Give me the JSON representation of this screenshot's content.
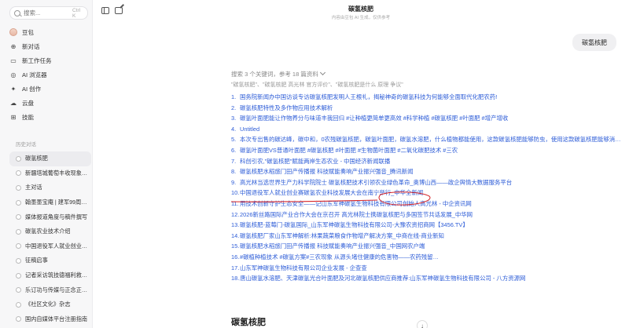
{
  "sidebar": {
    "search_placeholder": "搜索...",
    "search_shortcut": "Ctrl K",
    "nav": [
      {
        "label": "豆包",
        "icon": "avatar"
      },
      {
        "label": "新对话",
        "icon": "plus"
      },
      {
        "label": "新工作任务",
        "icon": "briefcase"
      },
      {
        "label": "AI 浏览器",
        "icon": "browser"
      },
      {
        "label": "AI 创作",
        "icon": "sparkle"
      },
      {
        "label": "云盘",
        "icon": "cloud"
      },
      {
        "label": "技能",
        "icon": "grid"
      }
    ],
    "history_title": "历史对话",
    "history": [
      {
        "label": "碳氢核肥",
        "active": true
      },
      {
        "label": "新疆塔城葡萄丰收现象…",
        "active": false
      },
      {
        "label": "主对话",
        "active": false
      },
      {
        "label": "翰墨墨宝庵 | 建军99周…",
        "active": false
      },
      {
        "label": "媒体报道角度与稿件撰写",
        "active": false
      },
      {
        "label": "碳氢农业技术介绍",
        "active": false
      },
      {
        "label": "中国退役军人就业创业…",
        "active": false
      },
      {
        "label": "征稿启事",
        "active": false
      },
      {
        "label": "记者采访筑技德福利救…",
        "active": false
      },
      {
        "label": "乐订功与传媒与正念正…",
        "active": false
      },
      {
        "label": "《社区文化》杂志",
        "active": false
      },
      {
        "label": "国内自媒体平台注册指南",
        "active": false
      }
    ]
  },
  "header": {
    "title": "碳氢核肥",
    "subtitle": "内容由豆包 AI 生成，仅供参考"
  },
  "chat": {
    "user_message": "碳氢核肥",
    "search_summary": "搜索 3 个关键词，参考 18 篇资料",
    "queries": "\"碳氢核肥\"、\"碳氢核肥 高光林 官方评价\"、\"碳氢核肥是什么 原理 争议\"",
    "results": [
      {
        "n": "1.",
        "text": "国务院新闻办中国访谈专访碳氢核肥发明人王根礼，揭秘神奇的碳氢科技为何能够全面取代化肥农药!"
      },
      {
        "n": "2.",
        "text": "碳氢核肥特性及多作物应用技术解析"
      },
      {
        "n": "3.",
        "text": "碳氢叶面肥能让作物养分与味道丰我回归 #让种植更简单更高效 #科学种植 #碳氢核肥 #叶面肥 #增产增收"
      },
      {
        "n": "4.",
        "text": "Untitled"
      },
      {
        "n": "5.",
        "text": "本次专出售的碳达峰，碳中和，0农残碳氢核肥，碳氢叶面肥，碳氢水溶肥，什么植物都能使用，这款碳氢核肥能够防虫，使用这款碳氢核肥能够消除重金…"
      },
      {
        "n": "6.",
        "text": "碳氢叶面肥VS普通叶面肥 #碳氢核肥 #叶面肥 #生物菌叶面肥 #二氧化碳肥技术 #三农"
      },
      {
        "n": "7.",
        "text": "科创引农,\"碳氢核肥\"赋能两岸生态农业 - 中国经济新闻联播"
      },
      {
        "n": "8.",
        "text": "碳氢核肥水稻旅门田产传播报 科技赋能奏响产业振兴强音_腾讯新闻"
      },
      {
        "n": "9.",
        "text": "高光林当选世界生产力科学院院士 碳氢核肥技术引领农业绿色革命_奥博山西——政企舆情大数据服务平台"
      },
      {
        "n": "10.",
        "text": "中国退役军人就业创业赛碳氢农业科技发展大会在南宁举行_中华全新闻"
      },
      {
        "n": "11.",
        "text": "用技术创新守护生态安全——记山东军神碳氢生物科技有限公司创始人高光林 - 中企资讯网"
      },
      {
        "n": "12.",
        "text": "2026新丝路国际产业合作大会在京召开 高光林院士携碳氢核肥与多国签节共话发展_中华网"
      },
      {
        "n": "13.",
        "text": "碳氢核肥-蓝莓门-碳氢国际_山东军神碳氢生物科技有限公司-大豫农资招商网【3456.TV】"
      },
      {
        "n": "14.",
        "text": "碳氢核肥厂家山东军神解析:林果蔬菜粮食作物增产解决方案_中商在线-商业新知"
      },
      {
        "n": "15.",
        "text": "碳氢核肥水稻旅门田产传播报 科技赋能奏响产业振兴强音_中国网农户端"
      },
      {
        "n": "16.",
        "text": "#碳植种植技术 #碳氢方案#三农现象 从源头堵住健康的危害物——农药残留…"
      },
      {
        "n": "17.",
        "text": "山东军神碳氢生物科技有限公司企业发展 - 企查查"
      },
      {
        "n": "18.",
        "text": "唐山碳氢水溶肥、天津碳氢光合叶面肥及河北碳氢核肥供应商推荐:山东军神碳氢生物科技有限公司 - 八方资源网"
      }
    ],
    "answer_title": "碳氢核肥"
  },
  "colors": {
    "link": "#2b5bd7",
    "annotation": "#d6262a",
    "sidebar_bg": "#f7f7f8"
  }
}
